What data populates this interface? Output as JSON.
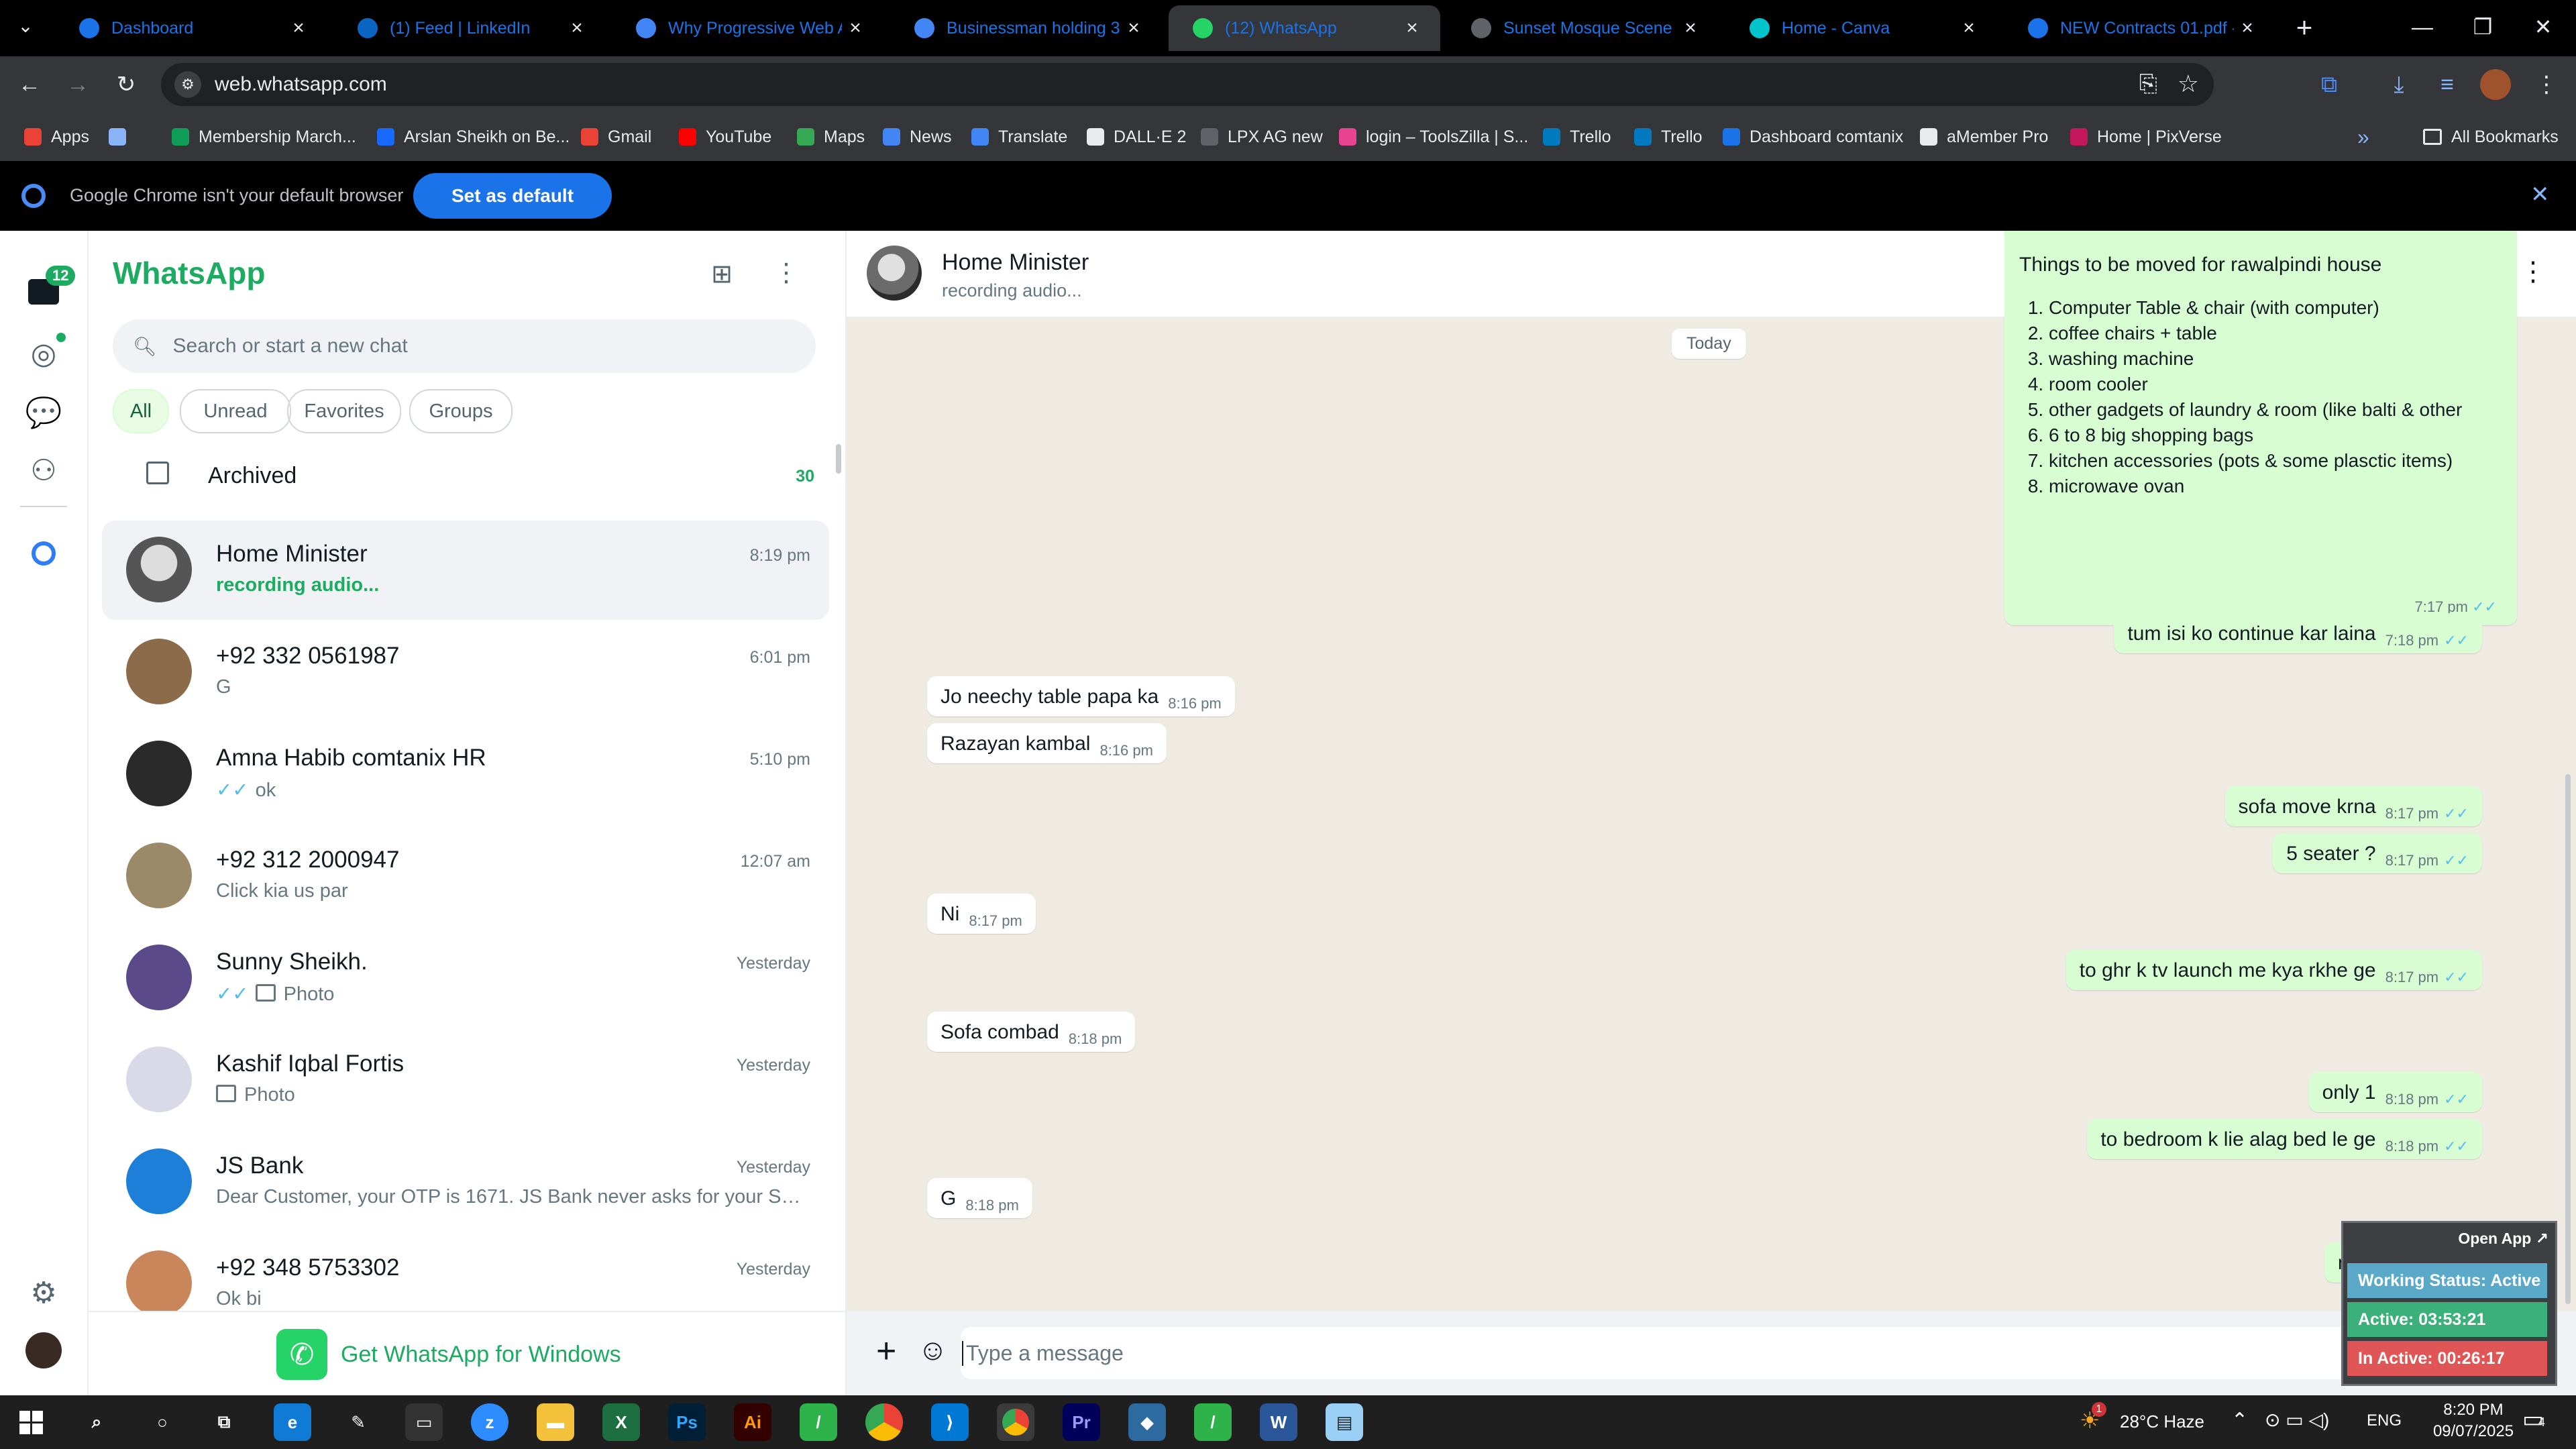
{
  "browser": {
    "tabs": [
      {
        "title": "Dashboard",
        "color": "#1a73e8"
      },
      {
        "title": "(1) Feed | LinkedIn",
        "color": "#0a66c2"
      },
      {
        "title": "Why Progressive Web Ap",
        "color": "#4285f4"
      },
      {
        "title": "Businessman holding 3d",
        "color": "#4285f4"
      },
      {
        "title": "(12) WhatsApp",
        "color": "#25d366"
      },
      {
        "title": "Sunset Mosque Scene Co",
        "color": "#5f6368"
      },
      {
        "title": "Home - Canva",
        "color": "#00c4cc"
      },
      {
        "title": "NEW Contracts 01.pdf -",
        "color": "#1a73e8"
      }
    ],
    "active_tab_index": 4,
    "url": "web.whatsapp.com",
    "bookmarks": [
      {
        "label": "Apps"
      },
      {
        "label": ""
      },
      {
        "label": "Membership March..."
      },
      {
        "label": "Arslan Sheikh on Be..."
      },
      {
        "label": "Gmail"
      },
      {
        "label": "YouTube"
      },
      {
        "label": "Maps"
      },
      {
        "label": "News"
      },
      {
        "label": "Translate"
      },
      {
        "label": "DALL·E 2"
      },
      {
        "label": "LPX AG new"
      },
      {
        "label": "login – ToolsZilla | S..."
      },
      {
        "label": "Trello"
      },
      {
        "label": "Trello"
      },
      {
        "label": "Dashboard comtanix"
      },
      {
        "label": "aMember Pro"
      },
      {
        "label": "Home | PixVerse"
      }
    ],
    "all_bookmarks": "All Bookmarks",
    "infobar": {
      "message": "Google Chrome isn't your default browser",
      "button": "Set as default"
    }
  },
  "whatsapp": {
    "unread_badge": "12",
    "title": "WhatsApp",
    "search_placeholder": "Search or start a new chat",
    "filters": [
      "All",
      "Unread",
      "Favorites",
      "Groups"
    ],
    "archived": {
      "label": "Archived",
      "count": "30"
    },
    "chats": [
      {
        "name": "Home Minister",
        "msg": "recording audio...",
        "time": "8:19 pm",
        "ticks": false,
        "photo": false,
        "highlight": true
      },
      {
        "name": "+92 332 0561987",
        "msg": "G",
        "time": "6:01 pm",
        "ticks": false,
        "photo": false,
        "highlight": false
      },
      {
        "name": "Amna Habib comtanix HR",
        "msg": "ok",
        "time": "5:10 pm",
        "ticks": true,
        "photo": false,
        "highlight": false
      },
      {
        "name": "+92 312 2000947",
        "msg": "Click kia us par",
        "time": "12:07 am",
        "ticks": false,
        "photo": false,
        "highlight": false
      },
      {
        "name": "Sunny Sheikh.",
        "msg": "Photo",
        "time": "Yesterday",
        "ticks": true,
        "photo": true,
        "highlight": false
      },
      {
        "name": "Kashif Iqbal Fortis",
        "msg": "Photo",
        "time": "Yesterday",
        "ticks": false,
        "photo": true,
        "highlight": false
      },
      {
        "name": "JS Bank",
        "msg": "Dear Customer, your OTP is 1671. JS Bank never asks for your SMS, E...",
        "time": "Yesterday",
        "ticks": false,
        "photo": false,
        "highlight": false
      },
      {
        "name": "+92 348 5753302",
        "msg": "Ok bi",
        "time": "Yesterday",
        "ticks": false,
        "photo": false,
        "highlight": false
      }
    ],
    "get_windows": "Get WhatsApp for Windows",
    "conversation": {
      "contact": "Home Minister",
      "status": "recording audio...",
      "date_chip": "Today",
      "list_message": {
        "heading": "Things to be moved for rawalpindi house",
        "items": [
          "Computer Table & chair (with computer)",
          "coffee chairs + table",
          "washing machine",
          "room cooler",
          "other gadgets of laundry & room (like balti & other",
          "6 to 8 big shopping bags",
          "kitchen accessories (pots & some plasctic items)",
          "microwave ovan"
        ],
        "time": "7:17 pm"
      },
      "messages": [
        {
          "text": "tum isi ko continue kar laina",
          "time": "7:18 pm",
          "dir": "out"
        },
        {
          "text": "Jo neechy table papa ka",
          "time": "8:16 pm",
          "dir": "in"
        },
        {
          "text": "Razayan kambal",
          "time": "8:16 pm",
          "dir": "in"
        },
        {
          "text": "sofa move krna",
          "time": "8:17 pm",
          "dir": "out"
        },
        {
          "text": "5 seater ?",
          "time": "8:17 pm",
          "dir": "out"
        },
        {
          "text": "Ni",
          "time": "8:17 pm",
          "dir": "in"
        },
        {
          "text": "to ghr k tv launch me kya rkhe ge",
          "time": "8:17 pm",
          "dir": "out"
        },
        {
          "text": "Sofa combad",
          "time": "8:18 pm",
          "dir": "in"
        },
        {
          "text": "only 1",
          "time": "8:18 pm",
          "dir": "out"
        },
        {
          "text": "to bedroom k lie alag bed le ge",
          "time": "8:18 pm",
          "dir": "out"
        },
        {
          "text": "G",
          "time": "8:18 pm",
          "dir": "in"
        },
        {
          "text": "mera ni khayal",
          "time": "",
          "dir": "out"
        }
      ],
      "input_placeholder": "Type a message"
    }
  },
  "tracker": {
    "open_app": "Open App ↗",
    "working_status": "Working Status: Active",
    "active": "Active: 03:53:21",
    "inactive": "In Active: 00:26:17"
  },
  "taskbar": {
    "weather": "28°C Haze",
    "lang": "ENG",
    "time": "8:20 PM",
    "date": "09/07/2025",
    "notifications": "4",
    "weather_badge": "1"
  },
  "colors": {
    "wa_green": "#1daa61",
    "bubble_out": "#d9fdd3",
    "tick_blue": "#53bdeb",
    "chrome_blue": "#1a73e8"
  }
}
